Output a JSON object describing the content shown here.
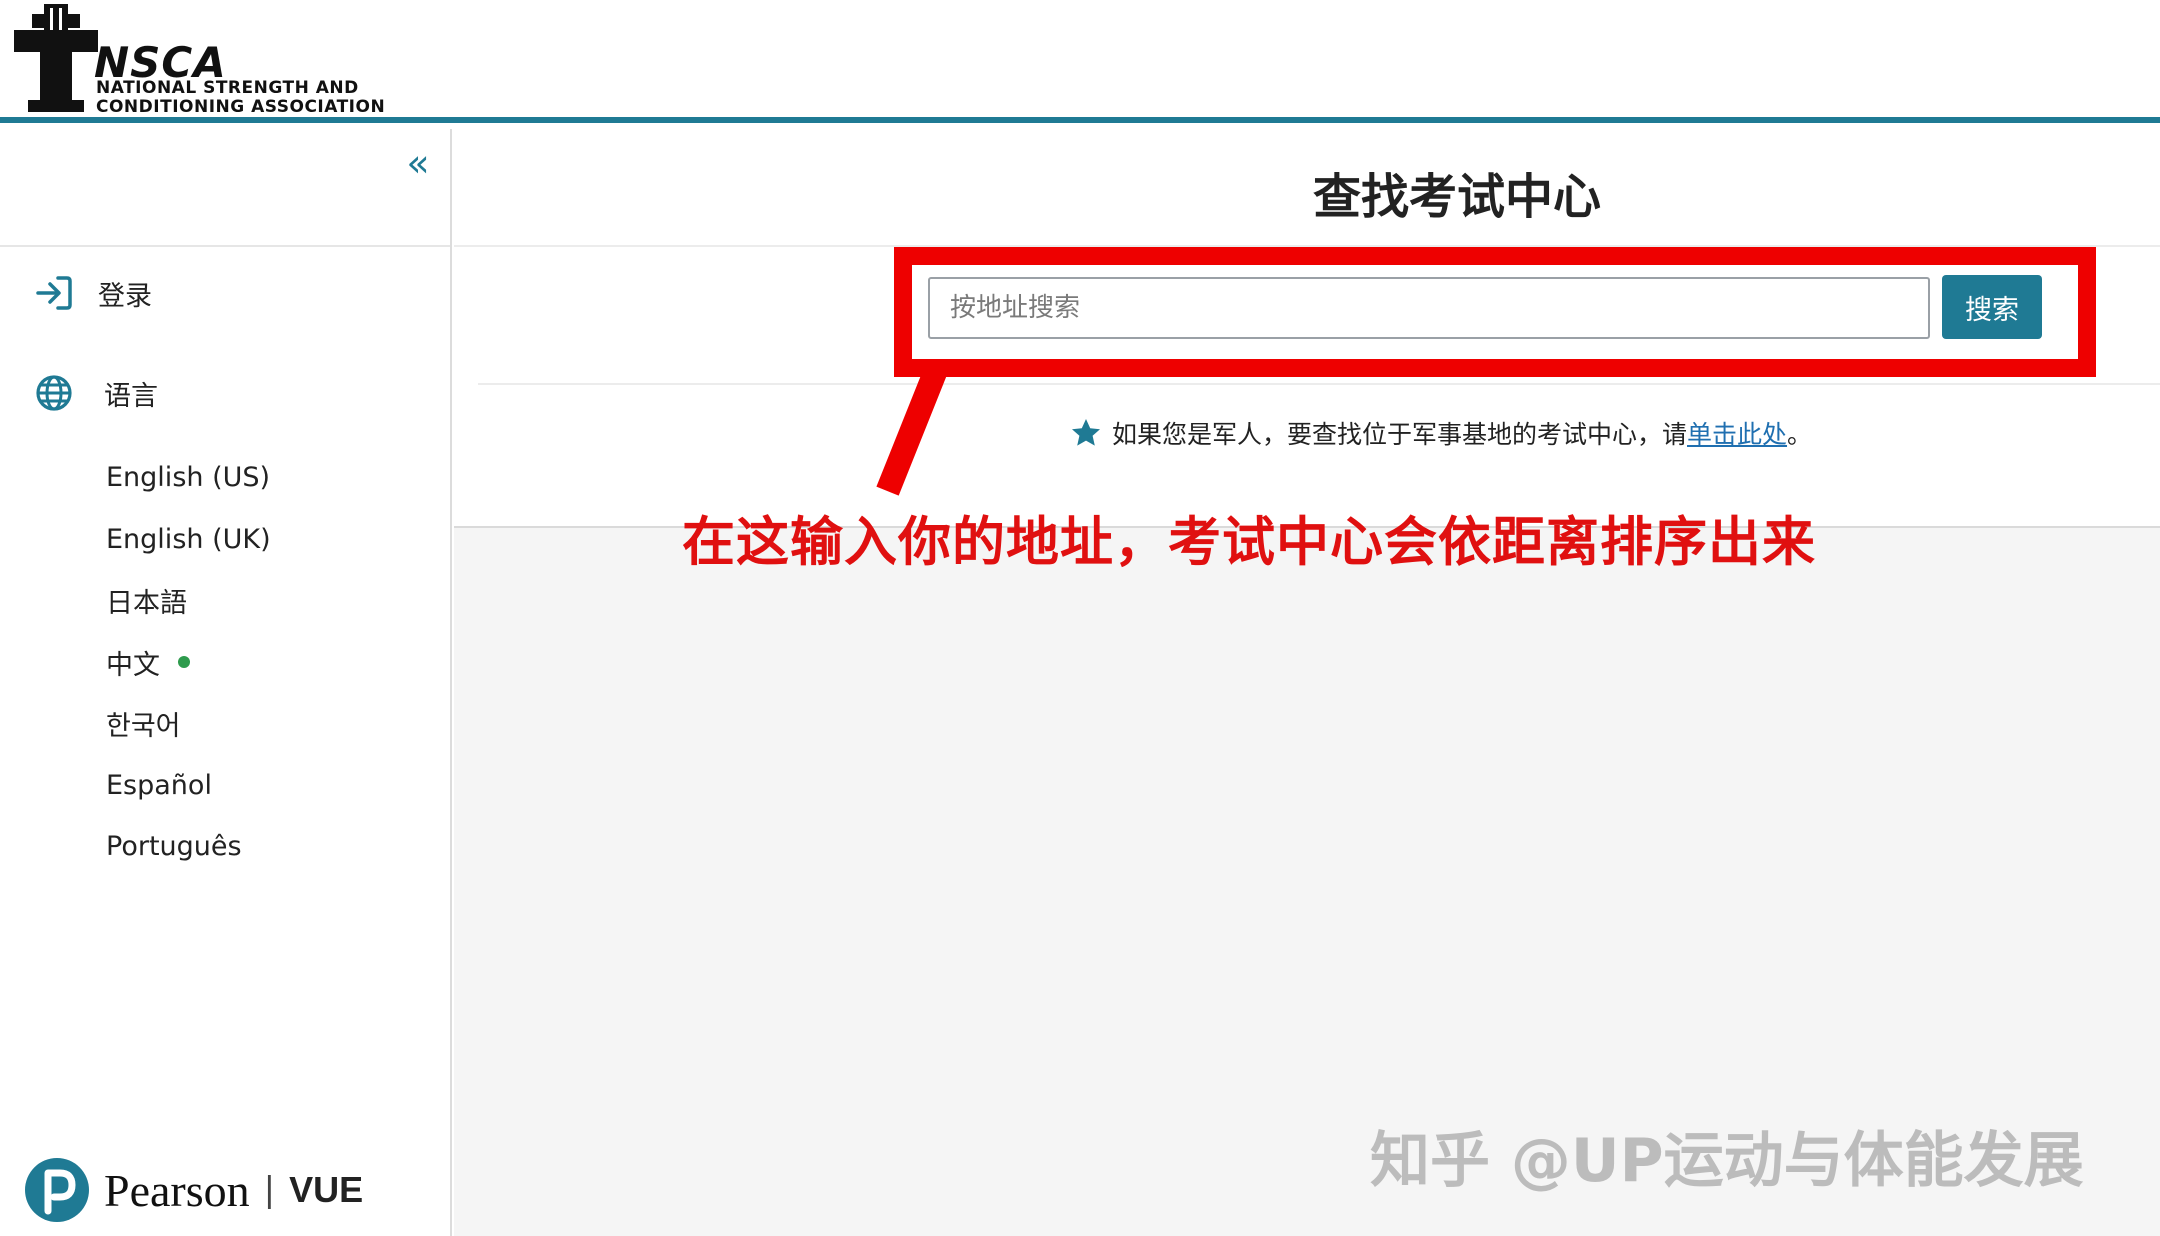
{
  "header": {
    "logo_word": "NSCA",
    "logo_line1": "NATIONAL STRENGTH AND",
    "logo_line2": "CONDITIONING ASSOCIATION"
  },
  "sidebar": {
    "collapse_glyph": "«",
    "login_label": "登录",
    "language_label": "语言",
    "languages": [
      "English (US)",
      "English (UK)",
      "日本語",
      "中文",
      "한국어",
      "Español",
      "Português"
    ],
    "selected_language_index": 3,
    "footer_brand": "Pearson",
    "footer_separator": "|",
    "footer_product": "VUE"
  },
  "main": {
    "title": "查找考试中心",
    "search_placeholder": "按地址搜索",
    "search_button": "搜索",
    "notice_text": "如果您是军人，要查找位于军事基地的考试中心，请",
    "notice_link": "单击此处",
    "notice_end": "。"
  },
  "annotation": {
    "text": "在这输入你的地址，考试中心会依距离排序出来",
    "color": "#ee0000"
  },
  "watermark": "知乎 @UP运动与体能发展",
  "colors": {
    "accent": "#1f7a94",
    "link": "#1f6fb0",
    "selected_dot": "#2e9b4d"
  },
  "icons": {
    "login": "login-arrow-icon",
    "language": "globe-icon",
    "notice": "star-icon",
    "collapse": "double-chevron-left-icon"
  }
}
